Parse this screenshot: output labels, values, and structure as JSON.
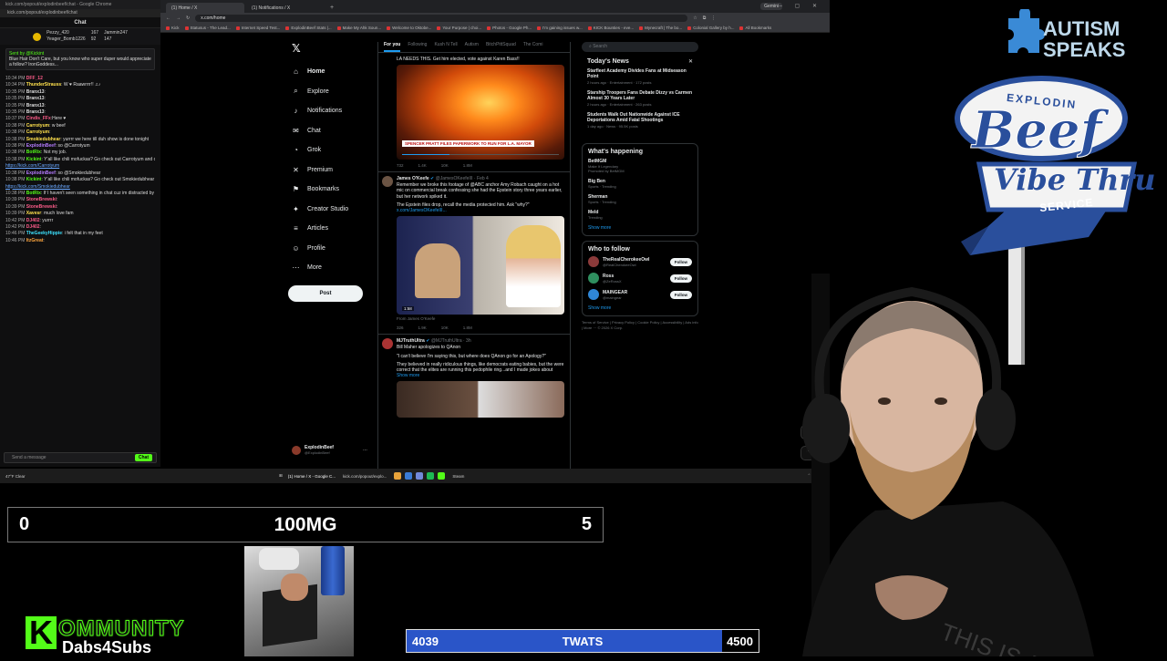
{
  "chat": {
    "title_bar": "kick.com/popout/explodinbeef/chat - Google Chrome",
    "url": "kick.com/popout/explodinbeef/chat",
    "header": "Chat",
    "gifters": [
      {
        "name": "Pezzy_420",
        "count": "167"
      },
      {
        "name": "Jammin247",
        "count": "147"
      },
      {
        "name": "Yeager_Bomb1226",
        "count": "92"
      }
    ],
    "pinned_by": "Sent by @Kickint",
    "pinned_text": "Blue Hair Don't Care, but you know who super duper would appreciate a follow? IronGoddess...",
    "messages": [
      {
        "time": "10:34 PM",
        "user": "DFF_12",
        "color": "pink",
        "text": ""
      },
      {
        "time": "10:34 PM",
        "user": "ThunderStrauss",
        "color": "yellow",
        "text": ": W ♥ Raawrrrr!! ♫♪"
      },
      {
        "time": "10:35 PM",
        "user": "Branx13",
        "color": "white",
        "text": ":"
      },
      {
        "time": "10:35 PM",
        "user": "Branx13",
        "color": "white",
        "text": ":"
      },
      {
        "time": "10:35 PM",
        "user": "Branx13",
        "color": "white",
        "text": ":"
      },
      {
        "time": "10:35 PM",
        "user": "Branx13",
        "color": "white",
        "text": ":"
      },
      {
        "time": "10:37 PM",
        "user": "Cindis_FFx",
        "color": "pink",
        "text": ":Here ♥"
      },
      {
        "time": "10:38 PM",
        "user": "Carrotyum",
        "color": "yellow",
        "text": ": w beef"
      },
      {
        "time": "10:38 PM",
        "user": "Carrotyum",
        "color": "yellow",
        "text": ":"
      },
      {
        "time": "10:38 PM",
        "user": "Smokiedubhear",
        "color": "yellow",
        "text": ": yurrrr we here till duh show is done tonight"
      },
      {
        "time": "10:38 PM",
        "user": "ExplodinBeef",
        "color": "purple",
        "text": ": so @Carrotyum"
      },
      {
        "time": "10:38 PM",
        "user": "BotRix",
        "color": "green",
        "text": ": Not my job."
      },
      {
        "time": "10:38 PM",
        "user": "Kickint",
        "color": "green",
        "text": ": Y'all like chili mofuckas? Go check out Carrotyum and drop them a follow at"
      },
      {
        "time": "",
        "user": "",
        "color": "link",
        "text": "https://kick.com/Carrotyum"
      },
      {
        "time": "10:38 PM",
        "user": "ExplodinBeef",
        "color": "purple",
        "text": ": so @Smokiedubhear"
      },
      {
        "time": "10:38 PM",
        "user": "Kickint",
        "color": "green",
        "text": ": Y'all like chili mofuckas? Go check out Smokiedubhear and drop them a follow at"
      },
      {
        "time": "",
        "user": "",
        "color": "link",
        "text": "https://kick.com/Smokiedubhear"
      },
      {
        "time": "10:38 PM",
        "user": "BotRix",
        "color": "green",
        "text": ": If I haven't seen something in chat cuz im distracted by the game hit me with a !tts message to get my attention <3"
      },
      {
        "time": "10:39 PM",
        "user": "StoneBrewski",
        "color": "pink",
        "text": ":"
      },
      {
        "time": "10:39 PM",
        "user": "StoneBrewski",
        "color": "pink",
        "text": ":"
      },
      {
        "time": "10:39 PM",
        "user": "Xavesr",
        "color": "yellow",
        "text": ": much love fam"
      },
      {
        "time": "10:42 PM",
        "user": "DJ402",
        "color": "pink",
        "text": ": yurrrr"
      },
      {
        "time": "10:42 PM",
        "user": "DJ402",
        "color": "pink",
        "text": ":"
      },
      {
        "time": "10:46 PM",
        "user": "TheGeekyHippie",
        "color": "cyan",
        "text": ": i felt that in my feet"
      },
      {
        "time": "10:46 PM",
        "user": "ItzGreat",
        "color": "orange",
        "text": ":"
      }
    ],
    "input_placeholder": "Send a message",
    "send_label": "Chat"
  },
  "browser": {
    "tabs": [
      "(1) Home / X",
      "(1) Notifications / X"
    ],
    "gemini_label": "Gemini",
    "url": "x.com/home",
    "bookmarks": [
      "Kick",
      "Statusus - The Lead...",
      "Internet Speed Test...",
      "ExplodinBeef Stats |...",
      "Make My Ahk Soun...",
      "Welcome to Oktobe...",
      "Your Purpose | choi...",
      "Photos - Google Ph...",
      "I'm gaining issues w...",
      "KICK Bounties - eve...",
      "Mynecraft | The bo...",
      "Colonial Gallery by h...",
      "All Bookmarks"
    ]
  },
  "x": {
    "nav": [
      {
        "label": "Home",
        "icon": "home-icon",
        "glyph": "⌂"
      },
      {
        "label": "Explore",
        "icon": "search-icon",
        "glyph": "⌕"
      },
      {
        "label": "Notifications",
        "icon": "bell-icon",
        "glyph": "♪"
      },
      {
        "label": "Chat",
        "icon": "chat-icon",
        "glyph": "✉"
      },
      {
        "label": "Grok",
        "icon": "grok-icon",
        "glyph": "◔"
      },
      {
        "label": "Premium",
        "icon": "x-premium-icon",
        "glyph": "✕"
      },
      {
        "label": "Bookmarks",
        "icon": "bookmark-icon",
        "glyph": "⚑"
      },
      {
        "label": "Creator Studio",
        "icon": "creator-studio-icon",
        "glyph": "✦"
      },
      {
        "label": "Articles",
        "icon": "articles-icon",
        "glyph": "≡"
      },
      {
        "label": "Profile",
        "icon": "profile-icon",
        "glyph": "☺"
      },
      {
        "label": "More",
        "icon": "more-icon",
        "glyph": "⋯"
      }
    ],
    "post_label": "Post",
    "profile_name": "ExplodinBeef",
    "profile_handle": "@ExplodinBeef",
    "timeline_tabs": [
      "For you",
      "Following",
      "Kush N Tell",
      "Autism",
      "BitchPittSquad",
      "The Comi"
    ],
    "tweets": [
      {
        "name": "",
        "handle": "",
        "text": "LA NEEDS THIS. Get him elected, vote against Karen Bass!!",
        "caption": "SPENCER PRATT FILES PAPERWORK TO RUN FOR L.A. MAYOR",
        "stats": [
          "732",
          "1.4K",
          "10K",
          "1.8M"
        ]
      },
      {
        "name": "James O'Keefe",
        "handle": "@JamesOKeefeIII · Feb 4",
        "text": "Remember we broke this footage of @ABC anchor Amy Robach caught on a hot mic on commercial break confessing she had the Epstein story three years earlier, but her network spiked it.",
        "text2": "The Epstein files drop, recall the media protected him. Ask \"why?\"",
        "link": "x.com/JamesOKeefeIII...",
        "from": "From James O'Keefe",
        "duration": "1:58",
        "stats": [
          "326",
          "1.9K",
          "10K",
          "1.8M"
        ]
      },
      {
        "name": "MJTruthUltra",
        "handle": "@MJTruthUltra · 3h",
        "text": "Bill Maher apologizes to QAnon",
        "text2": "\"I can't believe I'm saying this, but where does QAnon go for an Apology?\"",
        "text3": "They believed in really ridiculous things, like democrats eating babies, but the were correct that the elites are running this pedophile ring...and I made jokes about",
        "show_more": "Show more"
      }
    ],
    "search_placeholder": "Search",
    "todays_news_title": "Today's News",
    "news": [
      {
        "headline": "Starfleet Academy Divides Fans at Midseason Point",
        "meta": "2 hours ago · Entertainment · 172 posts"
      },
      {
        "headline": "Starship Troopers Fans Debate Dizzy vs Carmen Almost 30 Years Later",
        "meta": "2 hours ago · Entertainment · 263 posts"
      },
      {
        "headline": "Students Walk Out Nationwide Against ICE Deportations Amid Fatal Shootings",
        "meta": "1 day ago · News · 95.5K posts"
      }
    ],
    "happening_title": "What's happening",
    "trends": [
      {
        "context": "Make It Legendary",
        "name": "BetMGM",
        "sub": "Promoted by BetMGM"
      },
      {
        "context": "Sports · Trending",
        "name": "Big Ben",
        "sub": ""
      },
      {
        "context": "Sports · Trending",
        "name": "Sherman",
        "sub": ""
      },
      {
        "context": "Trending",
        "name": "Meld",
        "sub": ""
      }
    ],
    "show_more": "Show more",
    "who_to_follow_title": "Who to follow",
    "who_to_follow": [
      {
        "name": "TheRealCherokeeOwl",
        "handle": "@RealCherokeeOwl",
        "color": "#8b3a3a"
      },
      {
        "name": "Ross",
        "handle": "@ZeRossX",
        "color": "#2f8f5f"
      },
      {
        "name": "MAINGEAR",
        "handle": "@maingear",
        "color": "#2f86d6"
      }
    ],
    "follow_label": "Follow",
    "footer": "Terms of Service | Privacy Policy | Cookie Policy | Accessibility | Ads info | More ··· © 2026 X Corp."
  },
  "taskbar": {
    "weather": "47°F Clear",
    "items": [
      "(1) Home / X - Google C...",
      "kick.com/popout/explo...",
      "Steam"
    ]
  },
  "overlay": {
    "goal_left": "0",
    "goal_center": "100MG",
    "goal_right": "5",
    "twats_current": "4039",
    "twats_label": "TWATS",
    "twats_target": "4500",
    "twats_progress": 0.8976,
    "kommunity_k": "K",
    "kommunity_rest": "OMMUNITY",
    "kommunity_sub": "Dabs4Subs",
    "autism_speaks": "AUTISM SPEAKS",
    "sign_top": "EXPLODIN",
    "sign_beef": "Beef",
    "sign_vibe": "Vibe Thru",
    "sign_service": "SERVICE"
  },
  "colors": {
    "kick_green": "#53fc18",
    "x_blue": "#1d9bf0",
    "twats_fill": "#2a55c8",
    "sign_blue": "#2a4f9c"
  }
}
